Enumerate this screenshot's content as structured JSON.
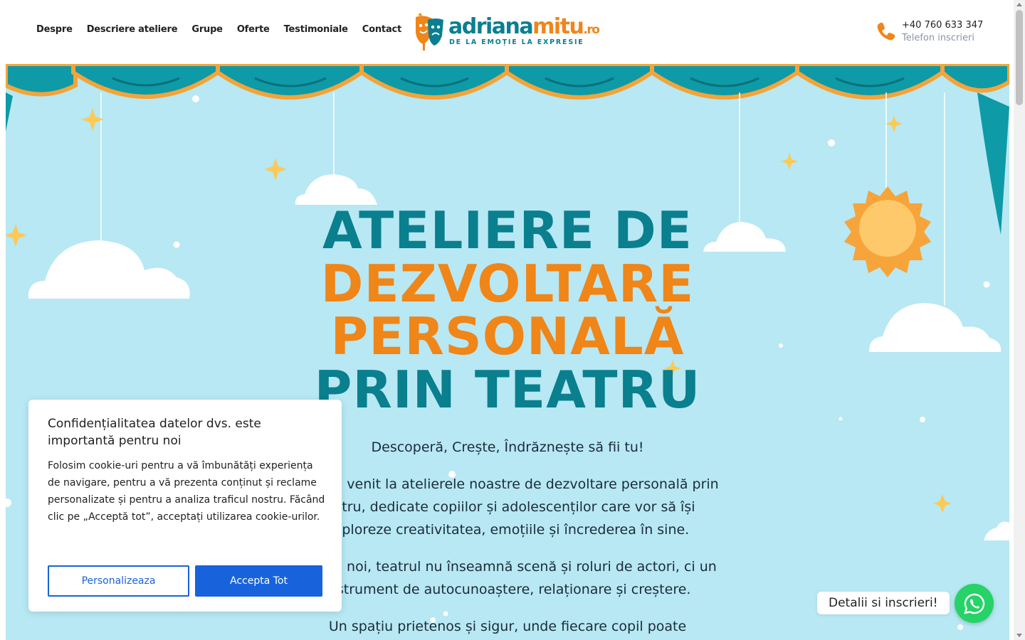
{
  "nav": {
    "items": [
      {
        "label": "Despre"
      },
      {
        "label": "Descriere ateliere"
      },
      {
        "label": "Grupe"
      },
      {
        "label": "Oferte"
      },
      {
        "label": "Testimoniale"
      },
      {
        "label": "Contact"
      }
    ]
  },
  "logo": {
    "part1": "adriana",
    "part2": "mitu",
    "part3": ".ro",
    "tagline": "DE LA EMOȚIE LA EXPRESIE"
  },
  "phone": {
    "number": "+40 760 633 347",
    "label": "Telefon inscrieri",
    "icon": "phone-icon"
  },
  "hero": {
    "title_line1": "ATELIERE DE",
    "title_line2": "DEZVOLTARE",
    "title_line3": "PERSONALĂ",
    "title_line4": "PRIN TEATRU",
    "subtitle": "Descoperă, Crește, Îndrăznește să fii tu!",
    "para1": "Bine ai venit la atelierele noastre de dezvoltare personală prin teatru, dedicate copiilor și adolescenților care vor să își exploreze creativitatea, emoțiile și încrederea în sine.",
    "para2": "Pentru noi, teatrul nu înseamnă scenă și roluri de actori, ci un instrument de autocunoaștere, relaționare și creștere.",
    "para3": "Un spațiu prietenos și sigur, unde fiecare copil poate"
  },
  "cookie": {
    "title": "Confidențialitatea datelor dvs. este importantă pentru noi",
    "text": "Folosim cookie-uri pentru a vă îmbunătăți experiența de navigare, pentru a vă prezenta conținut și reclame personalizate și pentru a analiza traficul nostru. Făcând clic pe „Acceptă tot”, acceptați utilizarea cookie-urilor.",
    "customize_label": "Personalizeaza",
    "accept_label": "Accepta Tot"
  },
  "whatsapp": {
    "label": "Detalii si inscrieri!",
    "icon": "whatsapp-icon"
  },
  "colors": {
    "teal": "#0a7f8e",
    "orange": "#f08518",
    "sky": "#b7e8f3",
    "cookie_blue": "#1863dc",
    "whatsapp_green": "#25d366"
  }
}
